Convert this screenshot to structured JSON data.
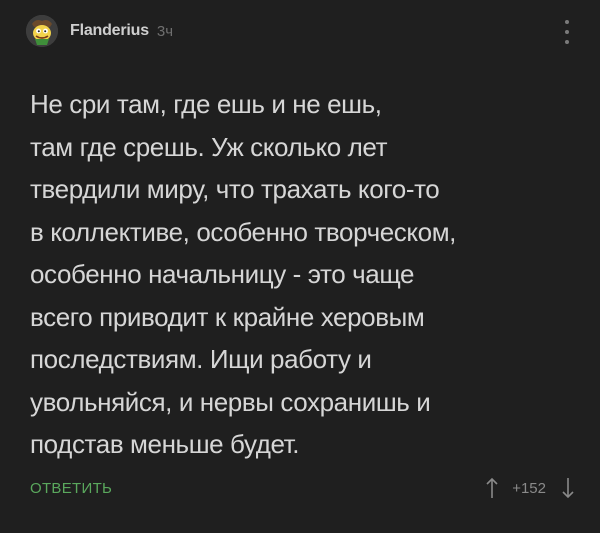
{
  "comment": {
    "author": "Flanderius",
    "time": "3ч",
    "avatar_icon": "cartoon-character-avatar",
    "body_lines": [
      "Не сри там, где ешь и не ешь,",
      "там где срешь. Уж сколько лет",
      "твердили миру, что трахать кого-то",
      "в коллективе, особенно творческом,",
      "особенно начальницу - это чаще",
      "всего приводит к крайне херовым",
      "последствиям.  Ищи работу и",
      "увольняйся, и нервы сохранишь и",
      "подстав меньше будет."
    ],
    "reply_label": "ОТВЕТИТЬ",
    "rating": "+152"
  },
  "colors": {
    "background": "#1f1f1f",
    "text": "#d6d6d6",
    "reply_accent": "#5aa85d",
    "muted": "#8a8a8a"
  }
}
